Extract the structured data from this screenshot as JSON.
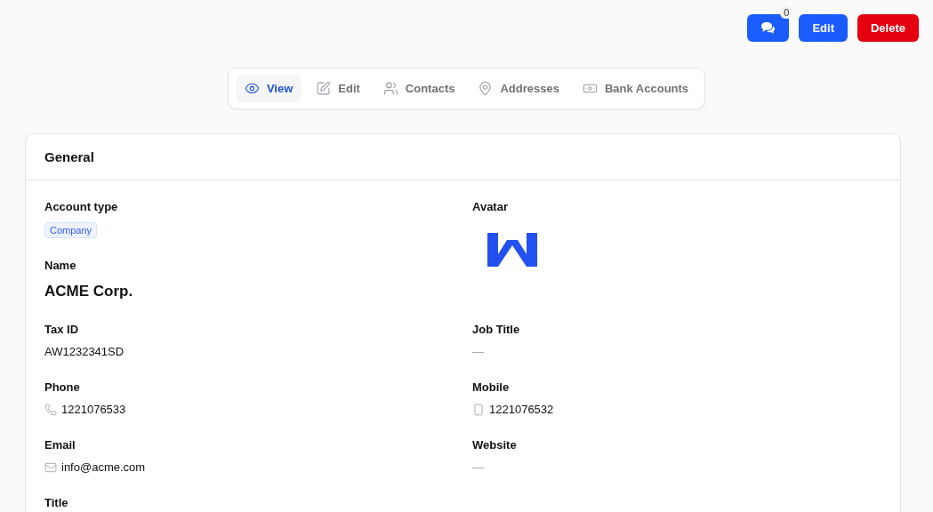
{
  "actions": {
    "comments_count": "0",
    "buttons": [
      {
        "label": "Edit",
        "kind": "primary"
      },
      {
        "label": "Delete",
        "kind": "danger"
      }
    ]
  },
  "tabs": [
    {
      "label": "View",
      "selected": true
    },
    {
      "label": "Edit",
      "selected": false
    },
    {
      "label": "Contacts",
      "selected": false
    },
    {
      "label": "Addresses",
      "selected": false
    },
    {
      "label": "Bank Accounts",
      "selected": false
    }
  ],
  "card": {
    "title": "General",
    "left": [
      {
        "label": "Account type",
        "kind": "badge",
        "value": "Company"
      },
      {
        "label": "Name",
        "kind": "title",
        "value": "ACME Corp."
      },
      {
        "label": "Tax ID",
        "kind": "text",
        "value": "AW1232341SD"
      },
      {
        "label": "Phone",
        "kind": "phone",
        "value": "1221076533"
      },
      {
        "label": "Email",
        "kind": "email",
        "value": "info@acme.com"
      },
      {
        "label": "Title",
        "kind": "label"
      }
    ],
    "right": [
      {
        "label": "Avatar",
        "kind": "image"
      },
      {
        "label": "Job Title",
        "kind": "empty",
        "value": "—"
      },
      {
        "label": "Mobile",
        "kind": "mobile",
        "value": "1221076532"
      },
      {
        "label": "Website",
        "kind": "empty",
        "value": "—"
      }
    ]
  }
}
